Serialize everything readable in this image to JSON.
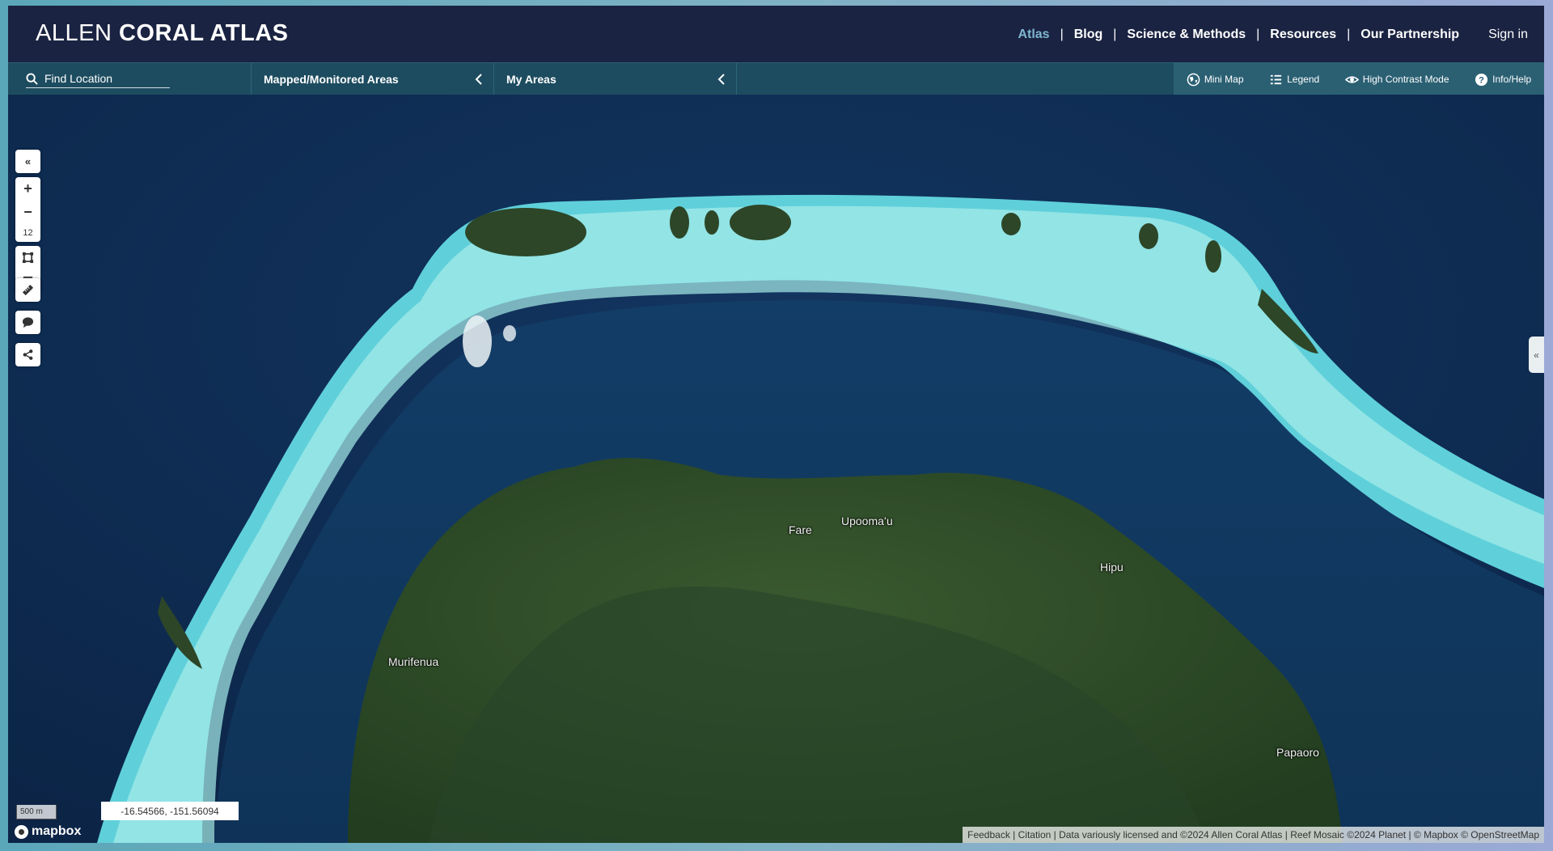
{
  "header": {
    "logo_light": "ALLEN",
    "logo_bold": "CORAL ATLAS",
    "nav": [
      "Atlas",
      "Blog",
      "Science & Methods",
      "Resources",
      "Our Partnership"
    ],
    "nav_active": "Atlas",
    "sign_in": "Sign in"
  },
  "toolbar": {
    "find_location": "Find Location",
    "mapped_areas": "Mapped/Monitored Areas",
    "my_areas": "My Areas",
    "tools": {
      "mini_map": "Mini Map",
      "legend": "Legend",
      "high_contrast": "High Contrast Mode",
      "info_help": "Info/Help"
    }
  },
  "map": {
    "zoom_level": "12",
    "scale": "500 m",
    "coordinates": "-16.54566, -151.56094",
    "mapbox": "mapbox",
    "attribution": "Feedback | Citation | Data variously licensed and ©2024 Allen Coral Atlas | Reef Mosaic ©2024 Planet | © Mapbox © OpenStreetMap",
    "places": {
      "fare": "Fare",
      "upooma": "Upoomaʻu",
      "hipu": "Hipu",
      "murifenua": "Murifenua",
      "papaoro": "Papaoro"
    }
  },
  "colors": {
    "header_bg": "#1a2341",
    "toolbar_bg": "#1d4c60",
    "active_nav": "#7fb6cf",
    "ocean": "#0f2a4a",
    "reef": "#5fd0da",
    "land": "#2f4f2a"
  }
}
